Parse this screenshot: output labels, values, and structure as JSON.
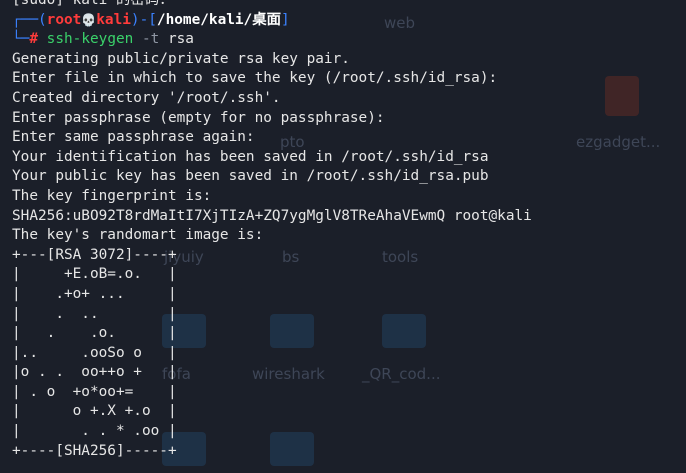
{
  "desktop": {
    "icons": [
      {
        "label": "web"
      },
      {
        "label": "pto"
      },
      {
        "label": "ezgadget..."
      },
      {
        "label": "jiyuiy"
      },
      {
        "label": "bs"
      },
      {
        "label": "tools"
      },
      {
        "label": "fofa"
      },
      {
        "label": "wireshark"
      },
      {
        "label": "_QR_cod..."
      }
    ]
  },
  "terminal": {
    "sudo_prompt": "[sudo] kali 的密码：",
    "prompt": {
      "open": "┌──(",
      "user": "root",
      "skull": "💀",
      "host": "kali",
      "mid": ")-[",
      "path": "/home/kali/桌面",
      "close": "]",
      "corner": "└─",
      "hash": "#"
    },
    "command": {
      "name": "ssh-keygen",
      "flag": "-t",
      "arg": "rsa"
    },
    "output": [
      "Generating public/private rsa key pair.",
      "Enter file in which to save the key (/root/.ssh/id_rsa):",
      "Created directory '/root/.ssh'.",
      "Enter passphrase (empty for no passphrase):",
      "Enter same passphrase again:",
      "Your identification has been saved in /root/.ssh/id_rsa",
      "Your public key has been saved in /root/.ssh/id_rsa.pub",
      "The key fingerprint is:",
      "SHA256:uBO92T8rdMaItI7XjTIzA+ZQ7ygMglV8TReAhaVEwmQ root@kali",
      "The key's randomart image is:"
    ],
    "randomart": [
      "+---[RSA 3072]----+",
      "|     +E.oB=.o.   |",
      "|    .+o+ ...     |",
      "|    .  ..        |",
      "|   .    .o.      |",
      "|..     .ooSo o   |",
      "|o . .  oo++o +   |",
      "| . o  +o*oo+=    |",
      "|      o +.X +.o  |",
      "|       . . * .oo |",
      "+----[SHA256]-----+"
    ]
  }
}
